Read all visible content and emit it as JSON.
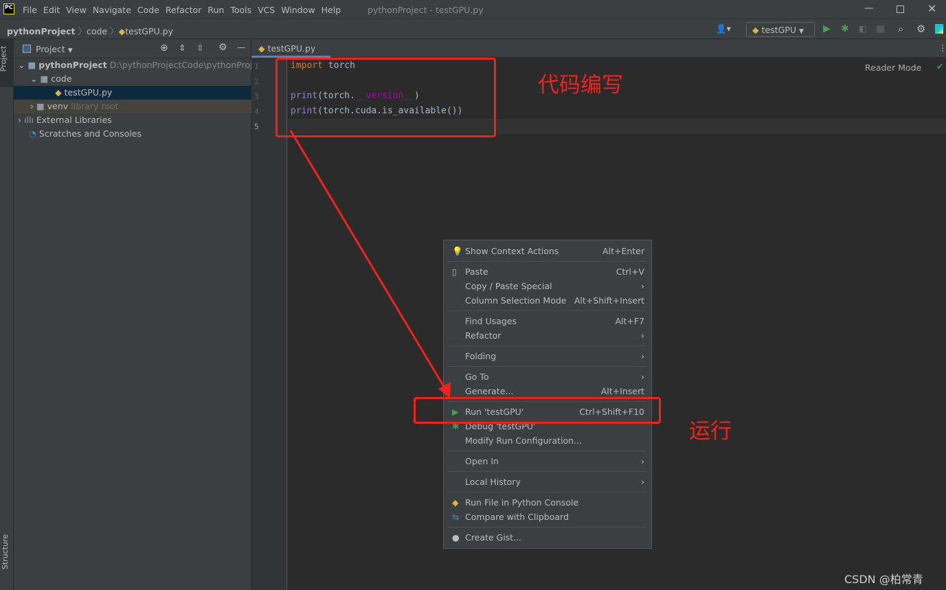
{
  "titlebar": {
    "menu": [
      "File",
      "Edit",
      "View",
      "Navigate",
      "Code",
      "Refactor",
      "Run",
      "Tools",
      "VCS",
      "Window",
      "Help"
    ],
    "title": "pythonProject - testGPU.py",
    "logo": "PC"
  },
  "breadcrumb": [
    "pythonProject",
    "code",
    "testGPU.py"
  ],
  "toolbar": {
    "run_config": "testGPU"
  },
  "sidebar": {
    "project_tab": "Project",
    "structure_tab": "Structure"
  },
  "project": {
    "header": "Project",
    "tree": [
      {
        "label": "pythonProject",
        "hint": "D:\\pythonProjectCode\\pythonProject"
      },
      {
        "label": "code"
      },
      {
        "label": "testGPU.py"
      },
      {
        "label": "venv",
        "hint": "library root"
      },
      {
        "label": "External Libraries"
      },
      {
        "label": "Scratches and Consoles"
      }
    ]
  },
  "editor": {
    "tab": "testGPU.py",
    "reader_mode": "Reader Mode",
    "line_numbers": [
      "1",
      "2",
      "3",
      "4",
      "5"
    ],
    "lines": [
      {
        "kw": "import",
        "rest": " torch"
      },
      {
        "fn": "print",
        "a": "(torch.",
        "b": "__version__",
        "c": ")"
      },
      {
        "fn": "print",
        "a": "(torch.cuda.is_available())"
      }
    ]
  },
  "context_menu": {
    "items": [
      {
        "label": "Show Context Actions",
        "shortcut": "Alt+Enter"
      },
      {
        "label": "Paste",
        "shortcut": "Ctrl+V"
      },
      {
        "label": "Copy / Paste Special",
        "shortcut": "›"
      },
      {
        "label": "Column Selection Mode",
        "shortcut": "Alt+Shift+Insert"
      },
      {
        "label": "Find Usages",
        "shortcut": "Alt+F7"
      },
      {
        "label": "Refactor",
        "shortcut": "›"
      },
      {
        "label": "Folding",
        "shortcut": "›"
      },
      {
        "label": "Go To",
        "shortcut": "›"
      },
      {
        "label": "Generate...",
        "shortcut": "Alt+Insert"
      },
      {
        "label": "Run 'testGPU'",
        "shortcut": "Ctrl+Shift+F10"
      },
      {
        "label": "Debug 'testGPU'",
        "shortcut": ""
      },
      {
        "label": "Modify Run Configuration...",
        "shortcut": ""
      },
      {
        "label": "Open In",
        "shortcut": "›"
      },
      {
        "label": "Local History",
        "shortcut": "›"
      },
      {
        "label": "Run File in Python Console",
        "shortcut": ""
      },
      {
        "label": "Compare with Clipboard",
        "shortcut": ""
      },
      {
        "label": "Create Gist...",
        "shortcut": ""
      }
    ]
  },
  "annotations": {
    "code_note": "代码编写",
    "run_note": "运行",
    "watermark": "CSDN @柏常青"
  },
  "colors": {
    "annotation": "#f0221c",
    "run_green": "#499c54"
  }
}
